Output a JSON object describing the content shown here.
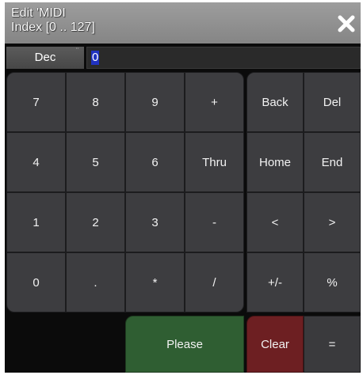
{
  "dialog": {
    "title_line1": "Edit 'MIDI",
    "title_line2": "Index [0 .. 127]",
    "close_icon": "close-x-icon"
  },
  "input": {
    "mode_label": "Dec",
    "grip_glyph": "¨",
    "value": "0"
  },
  "keypad": {
    "k7": "7",
    "k8": "8",
    "k9": "9",
    "plus": "+",
    "k4": "4",
    "k5": "5",
    "k6": "6",
    "thru": "Thru",
    "k1": "1",
    "k2": "2",
    "k3": "3",
    "minus": "-",
    "k0": "0",
    "dot": ".",
    "star": "*",
    "slash": "/",
    "please": "Please"
  },
  "navpad": {
    "back": "Back",
    "del": "Del",
    "home": "Home",
    "end": "End",
    "left": "<",
    "right": ">",
    "plusminus": "+/-",
    "percent": "%",
    "clear": "Clear",
    "equals": "="
  },
  "colors": {
    "please_bg": "#2f5e32",
    "clear_bg": "#6d1f22",
    "key_bg": "#3d3d40",
    "selection": "#2032c0"
  }
}
